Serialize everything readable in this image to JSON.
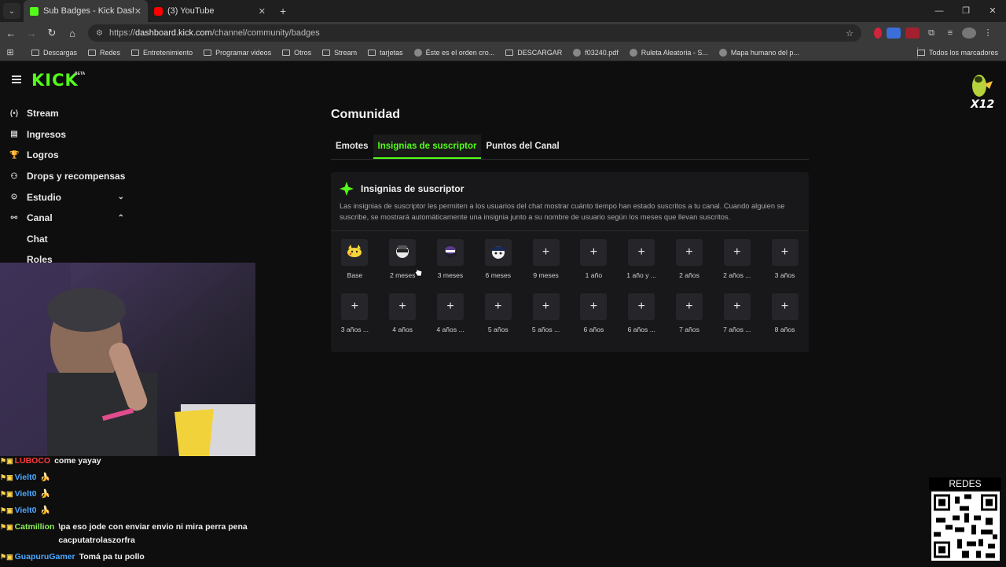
{
  "browser": {
    "tabs": [
      {
        "title": "Sub Badges - Kick Dashboard",
        "active": true,
        "favicon": "kick-icon"
      },
      {
        "title": "(3) YouTube",
        "active": false,
        "favicon": "youtube-icon"
      }
    ],
    "url_prefix": "https://",
    "url_host": "dashboard.kick.com",
    "url_path": "/channel/community/badges",
    "bookmarks": [
      {
        "label": "Descargas",
        "icon": "folder-icon"
      },
      {
        "label": "Redes",
        "icon": "folder-icon"
      },
      {
        "label": "Entretenimiento",
        "icon": "folder-icon"
      },
      {
        "label": "Programar videos",
        "icon": "folder-icon"
      },
      {
        "label": "Otros",
        "icon": "folder-icon"
      },
      {
        "label": "Stream",
        "icon": "folder-icon"
      },
      {
        "label": "tarjetas",
        "icon": "folder-icon"
      },
      {
        "label": "Éste es el orden cro...",
        "icon": "site-icon"
      },
      {
        "label": "DESCARGAR",
        "icon": "folder-icon"
      },
      {
        "label": "f03240.pdf",
        "icon": "site-icon"
      },
      {
        "label": "Ruleta Aleatoria - S...",
        "icon": "site-icon"
      },
      {
        "label": "Mapa humano del p...",
        "icon": "site-icon"
      }
    ],
    "all_bookmarks": "Todos los marcadores"
  },
  "app": {
    "logo": "KICK",
    "logo_badge": "BETA",
    "accent": "#53fc18",
    "nav": [
      {
        "label": "Stream",
        "icon": "broadcast-icon"
      },
      {
        "label": "Ingresos",
        "icon": "revenue-icon"
      },
      {
        "label": "Logros",
        "icon": "trophy-icon"
      },
      {
        "label": "Drops y recompensas",
        "icon": "drops-icon"
      },
      {
        "label": "Estudio",
        "icon": "studio-icon",
        "chevron": "⌄"
      },
      {
        "label": "Canal",
        "icon": "channel-icon",
        "chevron": "⌃"
      },
      {
        "label": "Chat",
        "sub": true
      },
      {
        "label": "Roles",
        "sub": true
      }
    ]
  },
  "main": {
    "title": "Comunidad",
    "tabs": [
      {
        "label": "Emotes",
        "active": false
      },
      {
        "label": "Insignias de suscriptor",
        "active": true
      },
      {
        "label": "Puntos del Canal",
        "active": false
      }
    ],
    "card": {
      "title": "Insignias de suscriptor",
      "description": "Las insignias de suscriptor les permiten a los usuarios del chat mostrar cuánto tiempo han estado suscritos a tu canal. Cuando alguien se suscribe, se mostrará automáticamente una insignia junto a su nombre de usuario según los meses que llevan suscritos."
    },
    "badges": [
      {
        "label": "Base",
        "filled": true,
        "icon": "pikachu-badge-icon"
      },
      {
        "label": "2 meses",
        "filled": true,
        "icon": "badge-2-icon"
      },
      {
        "label": "3 meses",
        "filled": true,
        "icon": "badge-3-icon"
      },
      {
        "label": "6 meses",
        "filled": true,
        "icon": "badge-6-icon"
      },
      {
        "label": "9 meses",
        "filled": false
      },
      {
        "label": "1 año",
        "filled": false
      },
      {
        "label": "1 año y ...",
        "filled": false
      },
      {
        "label": "2 años",
        "filled": false
      },
      {
        "label": "2 años ...",
        "filled": false
      },
      {
        "label": "3 años",
        "filled": false
      },
      {
        "label": "3 años ...",
        "filled": false
      },
      {
        "label": "4 años",
        "filled": false
      },
      {
        "label": "4 años ...",
        "filled": false
      },
      {
        "label": "5 años",
        "filled": false
      },
      {
        "label": "5 años ...",
        "filled": false
      },
      {
        "label": "6 años",
        "filled": false
      },
      {
        "label": "6 años ...",
        "filled": false
      },
      {
        "label": "7 años",
        "filled": false
      },
      {
        "label": "7 años ...",
        "filled": false
      },
      {
        "label": "8 años",
        "filled": false
      }
    ],
    "add_symbol": "+"
  },
  "overlay": {
    "chat": [
      {
        "user": "LUBOCO",
        "color": "#ff3b3b",
        "message": "come yayay"
      },
      {
        "user": "Vielt0",
        "color": "#4aa8ff",
        "message": "🍌"
      },
      {
        "user": "Vielt0",
        "color": "#4aa8ff",
        "message": "🍌"
      },
      {
        "user": "Vielt0",
        "color": "#4aa8ff",
        "message": "🍌"
      },
      {
        "user": "Catmillion",
        "color": "#8ef05a",
        "message": "\\pa eso jode con enviar envio ni mira perra pena cacputatrolaszorfra"
      },
      {
        "user": "GuapuruGamer",
        "color": "#4aa8ff",
        "message": "Tomá pa tu pollo"
      }
    ],
    "qr_label": "REDES"
  }
}
